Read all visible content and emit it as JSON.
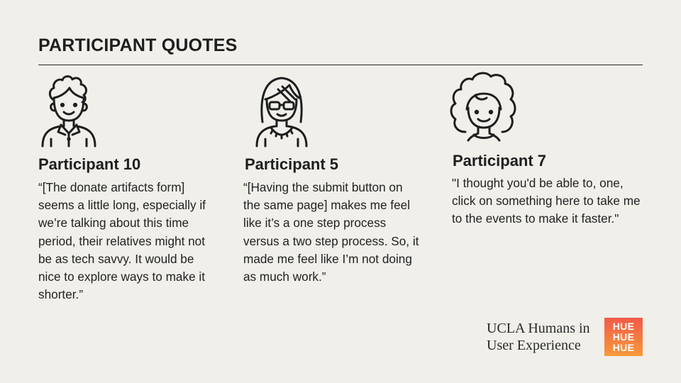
{
  "title": "PARTICIPANT QUOTES",
  "participants": [
    {
      "name": "Participant 10",
      "avatar_icon": "curly-boy-collared-shirt-icon",
      "quote": "“[The donate artifacts form] seems a little long, especially if we’re talking about this time period, their relatives might not be as tech savvy. It would be nice to explore ways to make it shorter.”"
    },
    {
      "name": "Participant 5",
      "avatar_icon": "woman-with-glasses-icon",
      "quote": "“[Having the submit button on the same page] makes me feel like it’s a one step process versus a two step process. So, it made me feel like I’m not doing as much work.”"
    },
    {
      "name": "Participant 7",
      "avatar_icon": "curly-hair-person-icon",
      "quote": "\"I thought you'd be able to, one, click on something here to take me to the events to make it faster.\""
    }
  ],
  "branding": {
    "line1": "UCLA Humans in",
    "line2": "User Experience",
    "logo_lines": [
      "HUE",
      "HUE",
      "HUE"
    ],
    "logo_colors": [
      "#f25a4a",
      "#f79a3a"
    ]
  }
}
